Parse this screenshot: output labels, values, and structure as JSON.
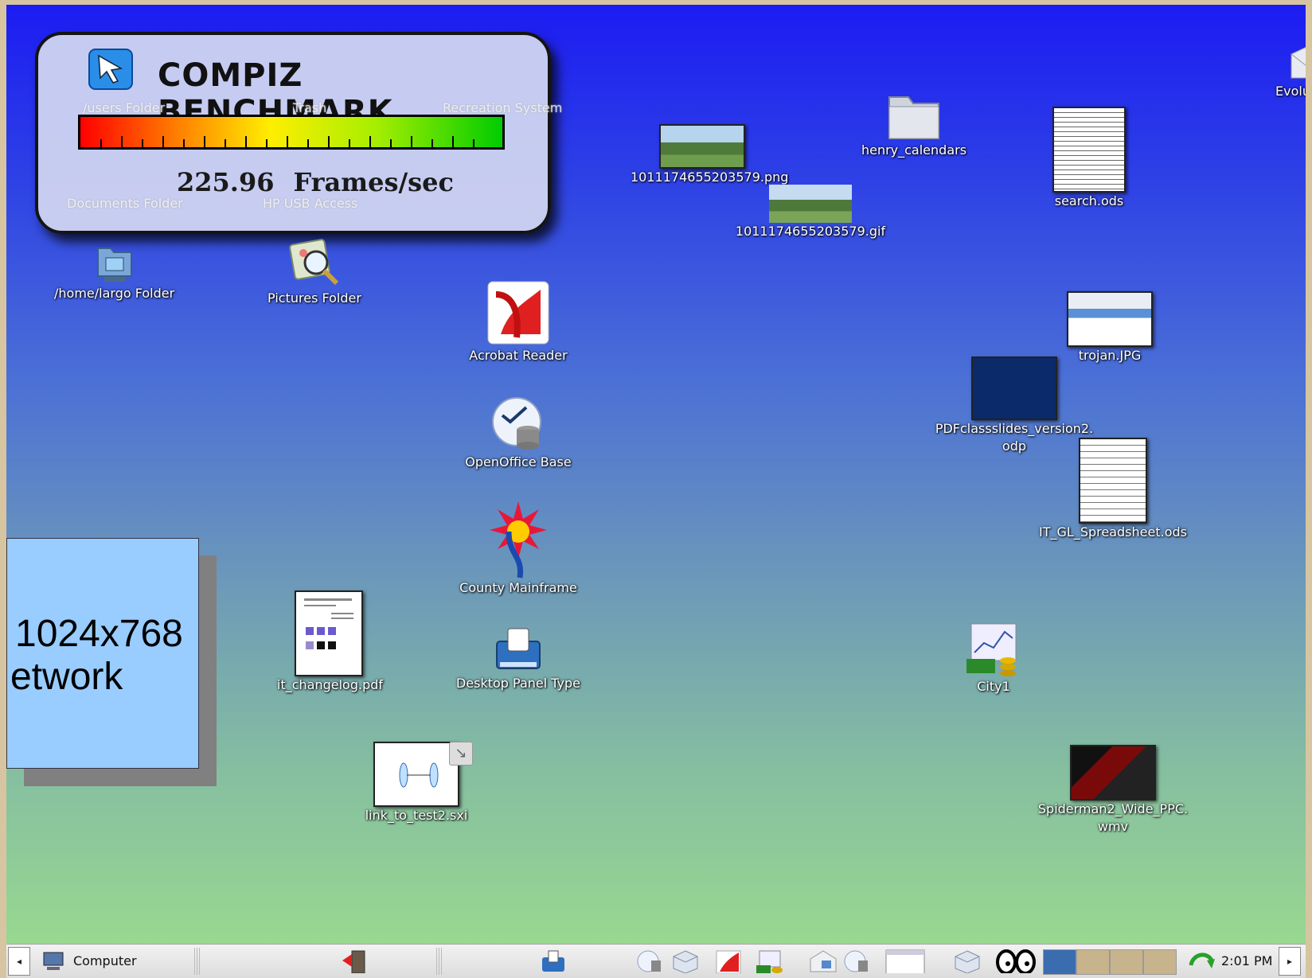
{
  "benchmark": {
    "title": "COMPIZ BENCHMARK",
    "fps_value": "225.96",
    "fps_unit": "Frames/sec",
    "ghost_labels": [
      "/users Folder",
      "Trash",
      "Recreation System",
      "Documents Folder",
      "HP USB Access"
    ]
  },
  "desktop_icons": {
    "home_folder": "/home/largo Folder",
    "pictures_folder": "Pictures Folder",
    "acrobat": "Acrobat Reader",
    "oo_base": "OpenOffice Base",
    "county": "County Mainframe",
    "desktop_panel": "Desktop Panel Type",
    "changelog": "it_changelog.pdf",
    "link_test": "link_to_test2.sxi",
    "png_file": "1011174655203579.png",
    "gif_file": "1011174655203579.gif",
    "henry": "henry_calendars",
    "search": "search.ods",
    "evolution": "Evoluti",
    "trojan": "trojan.JPG",
    "pdfclass_1": "PDFclassslides_version2.",
    "pdfclass_2": "odp",
    "itgl": "IT_GL_Spreadsheet.ods",
    "city": "City1",
    "spider_1": "Spiderman2_Wide_PPC.",
    "spider_2": "wmv"
  },
  "slide": {
    "line1": "1024x768",
    "line2": "etwork"
  },
  "taskbar": {
    "computer_label": "Computer",
    "clock": "2:01 PM",
    "left_arrow": "◂",
    "right_arrow": "▸"
  },
  "colors": {
    "desktop_top": "#1c1cf2",
    "desktop_bottom": "#98d890",
    "slide_bg": "#99ccff",
    "workspace_active": "#3a6cb0",
    "workspace_inactive": "#c8b48c"
  }
}
